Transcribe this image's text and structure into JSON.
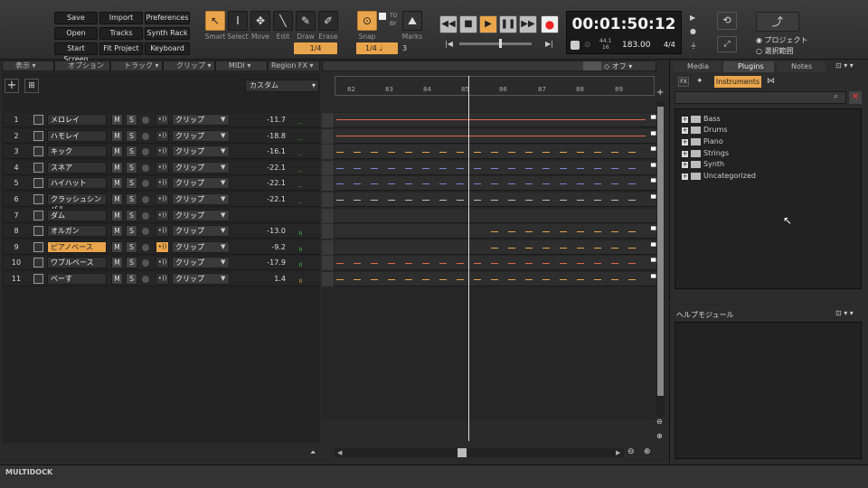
{
  "quick_buttons": {
    "save": "Save",
    "import": "Import",
    "preferences": "Preferences",
    "open": "Open",
    "tracks": "Tracks",
    "synth_rack": "Synth Rack",
    "start_screen": "Start Screen",
    "fit_project": "Fit Project",
    "keyboard": "Keyboard"
  },
  "tools": [
    "Smart",
    "Select",
    "Move",
    "Edit",
    "Draw",
    "Erase"
  ],
  "quantize": "1/4",
  "snap": {
    "label": "Snap",
    "value": "1/4",
    "extra": "3",
    "to": "TO",
    "by": "BY"
  },
  "marks": "Marks",
  "transport": {
    "time": "00:01:50:12",
    "sample_rate": "44.1",
    "bit_depth": "16",
    "tempo": "183.00",
    "signature": "4/4"
  },
  "scope": {
    "project": "プロジェクト",
    "selection": "選択範囲"
  },
  "menus": [
    "表示",
    "オプション",
    "トラック",
    "クリップ",
    "MIDI",
    "Region FX"
  ],
  "off_label": "オフ",
  "custom_label": "カスタム",
  "ruler": [
    "82",
    "83",
    "84",
    "85",
    "86",
    "87",
    "88",
    "89"
  ],
  "tracks": [
    {
      "num": "1",
      "name": "メロレイ",
      "inst": "クリップ",
      "vol": "-11.7"
    },
    {
      "num": "2",
      "name": "ハモレイ",
      "inst": "クリップ",
      "vol": "-18.8"
    },
    {
      "num": "3",
      "name": "キック",
      "inst": "クリップ",
      "vol": "-16.1"
    },
    {
      "num": "4",
      "name": "スネア",
      "inst": "クリップ",
      "vol": "-22.1"
    },
    {
      "num": "5",
      "name": "ハイハット",
      "inst": "クリップ",
      "vol": "-22.1"
    },
    {
      "num": "6",
      "name": "クラッシュシンバル",
      "inst": "クリップ",
      "vol": "-22.1"
    },
    {
      "num": "7",
      "name": "ダム",
      "inst": "クリップ",
      "vol": ""
    },
    {
      "num": "8",
      "name": "オルガン",
      "inst": "クリップ",
      "vol": "-13.0"
    },
    {
      "num": "9",
      "name": "ピアノベース",
      "inst": "クリップ",
      "vol": "-9.2"
    },
    {
      "num": "10",
      "name": "ワブルベース",
      "inst": "クリップ",
      "vol": "-17.9"
    },
    {
      "num": "11",
      "name": "ベーす",
      "inst": "クリップ",
      "vol": "1.4"
    }
  ],
  "right_panel": {
    "tabs": [
      "Media",
      "Plugins",
      "Notes"
    ],
    "subtab": "Instruments",
    "categories": [
      "Bass",
      "Drums",
      "Piano",
      "Strings",
      "Synth",
      "Uncategorized"
    ],
    "help_title": "ヘルプモジュール"
  },
  "multidock": "MULTIDOCK",
  "mute": "M",
  "solo": "S"
}
